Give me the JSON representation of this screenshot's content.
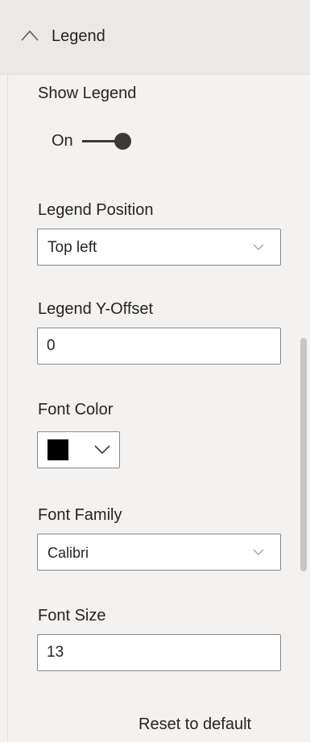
{
  "section": {
    "title": "Legend",
    "expanded": true
  },
  "show_legend": {
    "label": "Show Legend",
    "toggle_text": "On",
    "value": true
  },
  "legend_position": {
    "label": "Legend Position",
    "selected": "Top left"
  },
  "legend_y_offset": {
    "label": "Legend Y-Offset",
    "value": "0"
  },
  "font_color": {
    "label": "Font Color",
    "swatch_color": "#000000"
  },
  "font_family": {
    "label": "Font Family",
    "selected": "Calibri"
  },
  "font_size": {
    "label": "Font Size",
    "value": "13"
  },
  "reset": {
    "label": "Reset to default"
  },
  "icons": {
    "header": "chevron-up-icon",
    "dropdown": "chevron-down-icon"
  },
  "colors": {
    "background": "#f3f2f1",
    "header_background": "#ebe9e8",
    "text": "#252423",
    "border": "#8a8886",
    "toggle": "#3b3a39"
  }
}
